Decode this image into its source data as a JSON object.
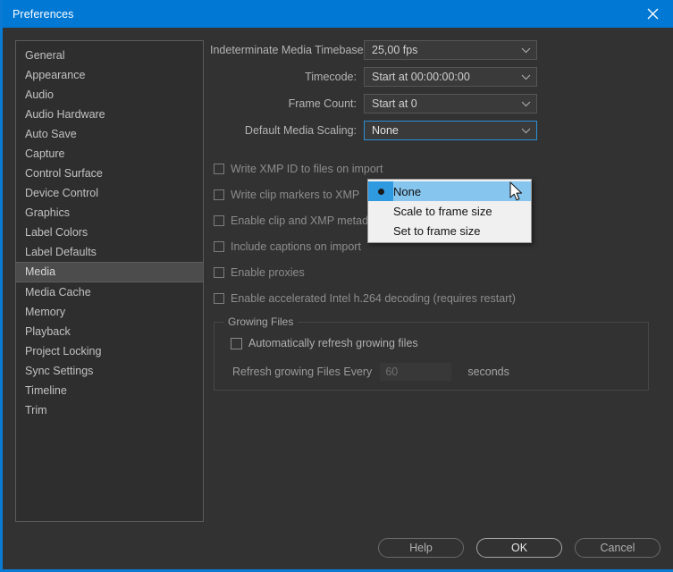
{
  "window": {
    "title": "Preferences",
    "close_icon": "close-icon",
    "accent_color": "#0078d4",
    "background_color": "#323232"
  },
  "sidebar": {
    "items": [
      {
        "label": "General",
        "selected": false
      },
      {
        "label": "Appearance",
        "selected": false
      },
      {
        "label": "Audio",
        "selected": false
      },
      {
        "label": "Audio Hardware",
        "selected": false
      },
      {
        "label": "Auto Save",
        "selected": false
      },
      {
        "label": "Capture",
        "selected": false
      },
      {
        "label": "Control Surface",
        "selected": false
      },
      {
        "label": "Device Control",
        "selected": false
      },
      {
        "label": "Graphics",
        "selected": false
      },
      {
        "label": "Label Colors",
        "selected": false
      },
      {
        "label": "Label Defaults",
        "selected": false
      },
      {
        "label": "Media",
        "selected": true
      },
      {
        "label": "Media Cache",
        "selected": false
      },
      {
        "label": "Memory",
        "selected": false
      },
      {
        "label": "Playback",
        "selected": false
      },
      {
        "label": "Project Locking",
        "selected": false
      },
      {
        "label": "Sync Settings",
        "selected": false
      },
      {
        "label": "Timeline",
        "selected": false
      },
      {
        "label": "Trim",
        "selected": false
      }
    ]
  },
  "main": {
    "fields": [
      {
        "label": "Indeterminate Media Timebase:",
        "value": "25,00 fps",
        "focused": false
      },
      {
        "label": "Timecode:",
        "value": "Start at 00:00:00:00",
        "focused": false
      },
      {
        "label": "Frame Count:",
        "value": "Start at 0",
        "focused": false
      },
      {
        "label": "Default Media Scaling:",
        "value": "None",
        "focused": true
      }
    ],
    "checkboxes": [
      {
        "label": "Write XMP ID to files  on import",
        "checked": false
      },
      {
        "label": "Write clip markers to XMP",
        "checked": false
      },
      {
        "label": "Enable clip and XMP metadata linking",
        "checked": false
      },
      {
        "label": "Include captions on import",
        "checked": false
      },
      {
        "label": "Enable proxies",
        "checked": false
      },
      {
        "label": "Enable accelerated  Intel h.264 decoding (requires  restart)",
        "checked": false
      }
    ],
    "growing_files": {
      "title": "Growing Files",
      "auto_refresh_label": "Automatically refresh growing files",
      "auto_refresh_checked": false,
      "interval_label": "Refresh growing Files Every",
      "interval_value": "60",
      "interval_placeholder": "60",
      "units_label": "seconds"
    }
  },
  "dropdown": {
    "open": true,
    "options": [
      {
        "label": "None",
        "selected": true
      },
      {
        "label": "Scale to frame size",
        "selected": false
      },
      {
        "label": "Set to frame size",
        "selected": false
      }
    ]
  },
  "footer": {
    "help_label": "Help",
    "ok_label": "OK",
    "cancel_label": "Cancel"
  }
}
